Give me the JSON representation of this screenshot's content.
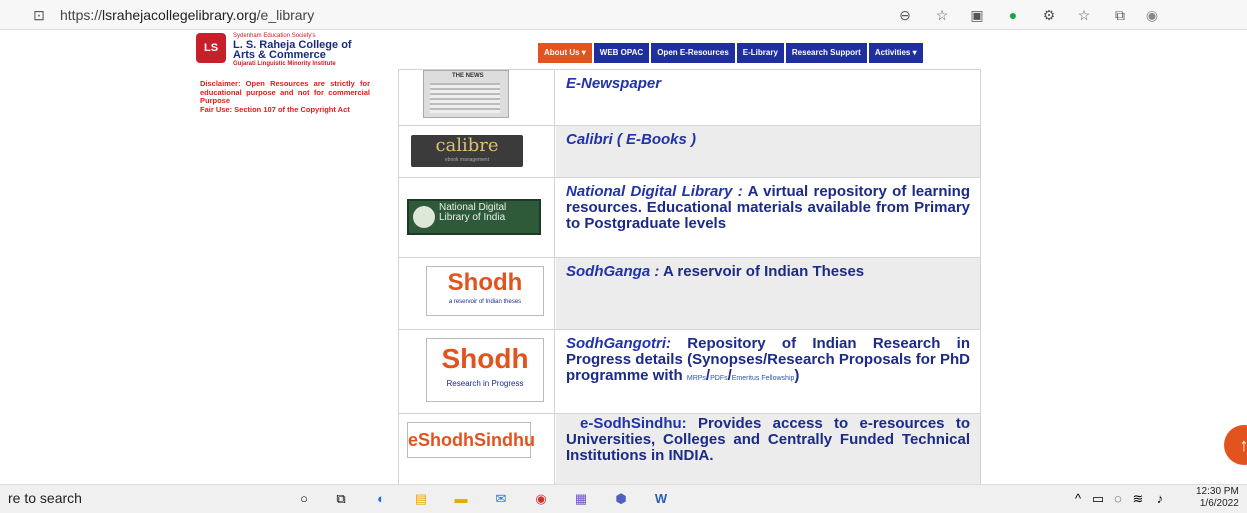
{
  "browser": {
    "url_prefix": "https://",
    "url_main": "lsrahejacollegelibrary.org",
    "url_path": "/e_library"
  },
  "header": {
    "logo_badge": "LS",
    "society": "Sydenham Education Society's",
    "college_line1": "L. S. Raheja College of",
    "college_line2": "Arts & Commerce",
    "tagline": "Gujarati Linguistic Minority Institute"
  },
  "nav": {
    "items": [
      "About Us ▾",
      "WEB OPAC",
      "Open E-Resources",
      "E-Library",
      "Research Support",
      "Activities ▾"
    ]
  },
  "sidebar": {
    "disclaimer": "Disclaimer: Open Resources are strictly for educational purpose and not for commercial Purpose",
    "fair_use": "Fair Use: Section 107 of the Copyright Act"
  },
  "resources": [
    {
      "thumb_label": "THE NEWS",
      "title": "E-Newspaper",
      "desc": ""
    },
    {
      "thumb_label": "calibre",
      "thumb_sub": "ebook management",
      "title": "Calibri ( E-Books )",
      "desc": ""
    },
    {
      "thumb_label": "National Digital Library of India",
      "title": "National Digital Library :",
      "desc": "A virtual repository of learning resources. Educational materials available from Primary to Postgraduate levels"
    },
    {
      "thumb_label": "Shodh",
      "thumb_sub": "a reservoir of Indian theses",
      "title": "SodhGanga :",
      "desc": "A reservoir of Indian Theses"
    },
    {
      "thumb_label": "Shodh",
      "thumb_sub": "Research in Progress",
      "title": "SodhGangotri:",
      "desc": "Repository of Indian Research in Progress details (Synopses/Research Proposals for PhD programme with",
      "links": [
        "MRPs",
        "PDFs",
        "Emeritus Fellowship"
      ]
    },
    {
      "thumb_label": "eShodhSindhu",
      "title": "e-SodhSindhu:",
      "desc": "Provides access to e-resources to Universities, Colleges and Centrally Funded Technical Institutions in INDIA."
    }
  ],
  "taskbar": {
    "search": "re to search",
    "time": "12:30 PM",
    "date": "1/6/2022"
  },
  "colors": {
    "nav_blue": "#1f2fa0",
    "nav_orange": "#e2531e",
    "disclaimer_red": "#e21b1b",
    "title_blue": "#1c2a88"
  }
}
